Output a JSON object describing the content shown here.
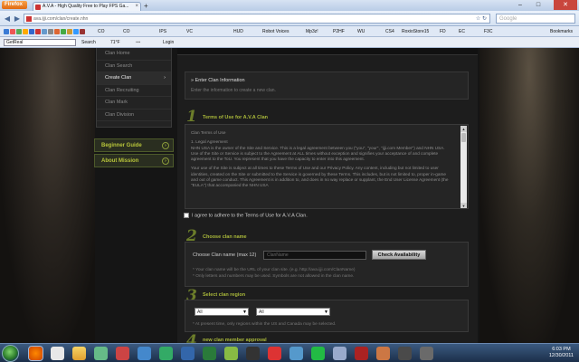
{
  "browser": {
    "app_label": "Firefox",
    "tab_title": "A.V.A - High Quality Free to Play FPS Ga...",
    "url": "ava.ijji.com/clan/create.nhn",
    "search_placeholder": "Google",
    "bookmarks_label": "Bookmarks",
    "bookmarks": [
      "CO",
      "CO",
      "IPS",
      "VC",
      "HUD",
      "Robot Voices",
      "Mp3z!",
      "P2HF",
      "WU",
      "CS4",
      "RoxioStore15",
      "FD",
      "EC",
      "F3C"
    ],
    "toolbar2": {
      "search_select": "GetReal",
      "search_btn": "Search",
      "count": "71°F",
      "login": "Login"
    }
  },
  "sidebar": {
    "items": [
      {
        "label": "Clan Home"
      },
      {
        "label": "Clan Search"
      },
      {
        "label": "Create Clan",
        "active": true
      },
      {
        "label": "Clan Recruiting"
      },
      {
        "label": "Clan Mark"
      },
      {
        "label": "Clan Division"
      }
    ],
    "active_arrow": "›",
    "guides": [
      {
        "label": "Beginner Guide"
      },
      {
        "label": "About Mission"
      }
    ]
  },
  "main": {
    "info_title": "» Enter Clan Information",
    "info_sub": "Enter the information to create a new clan.",
    "step1": {
      "num": "1",
      "title": "Terms of Use for A.V.A Clan"
    },
    "terms": {
      "heading": "Clan Terms of Use",
      "section": "1. Legal Agreement",
      "p1": "NHN USA is the owner of the Site and Service. This is a legal agreement between you (\"you\", \"your\", \"ijji.com Member\") and NHN USA. Use of the Site or Service is subject to the Agreement at ALL times without exception and signifies your acceptance of and complete agreement to the ToU. You represent that you have the capacity to enter into this agreement.",
      "p2": "Your use of the Site is subject at all times to these Terms of Use and our Privacy Policy. Any content, including but not limited to user identities, created on the Site or submitted to the Service is governed by these Terms. This includes, but is not limited to, proper in-game and out of game conduct. This Agreement is in addition to, and does in no way replace or supplant, the End User License Agreement (the \"EULA\") that accompanied the NHN USA"
    },
    "agree_label": "I agree to adhere to the Terms of Use for A.V.A Clan.",
    "step2": {
      "num": "2",
      "title": "Choose clan name"
    },
    "clan_name": {
      "label": "Choose Clan name (max 12)",
      "placeholder": "ClanName",
      "button": "Check Availability",
      "hint1": "* Your clan name will be the URL of your clan site. (e.g. http://ava.ijji.com/ClanName)",
      "hint2": "* Only letters and numbers may be used. Symbols are not allowed in the clan name."
    },
    "step3": {
      "num": "3",
      "title": "Select clan region"
    },
    "region": {
      "select1": "All",
      "select2": "All",
      "hint": "* At present time, only regions within the US and Canada may be selected."
    },
    "step4": {
      "num": "4",
      "title": "new clan member approval"
    }
  },
  "taskbar": {
    "time": "6:03 PM",
    "date": "12/30/2011"
  }
}
